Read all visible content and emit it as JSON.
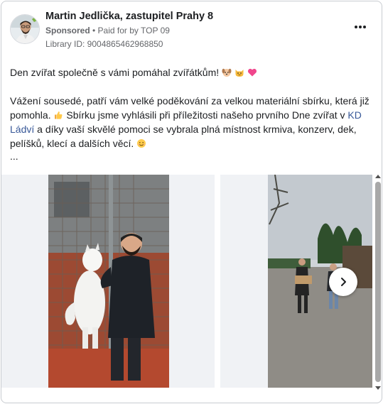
{
  "header": {
    "page_name": "Martin Jedlička, zastupitel Prahy 8",
    "sponsored_label": "Sponsored",
    "separator": " • ",
    "paid_for": "Paid for by TOP 09",
    "library_id": "Library ID: 9004865462968850",
    "more_icon": "more-horizontal-icon"
  },
  "post": {
    "line1": "Den zvířat společně s vámi pomáhal zvířátkům!",
    "para2_part1": "Vážení sousedé, patří vám velké poděkování za velkou materiální sbírku, která již pomohla.",
    "para2_part2": " Sbírku jsme vyhlásili při příležitosti našeho prvního Dne zvířat v ",
    "link_text": "KD Ládví",
    "para2_part3": " a díky vaší skvělé pomoci se vybrala plná místnost krmiva, konzerv, dek, pelíšků, klecí a dalších věcí.",
    "ellipsis": "..."
  },
  "emojis": [
    "dog-face-icon",
    "cat-face-icon",
    "heart-icon",
    "thumbs-up-icon",
    "smiling-face-icon"
  ],
  "carousel": {
    "slides": [
      {
        "alt_name": "photo-man-with-white-dog"
      },
      {
        "alt_name": "photo-people-carrying-boxes"
      }
    ],
    "next_icon": "chevron-right-icon"
  },
  "colors": {
    "link": "#385898",
    "meta": "#65676b",
    "text": "#1c1e21"
  }
}
